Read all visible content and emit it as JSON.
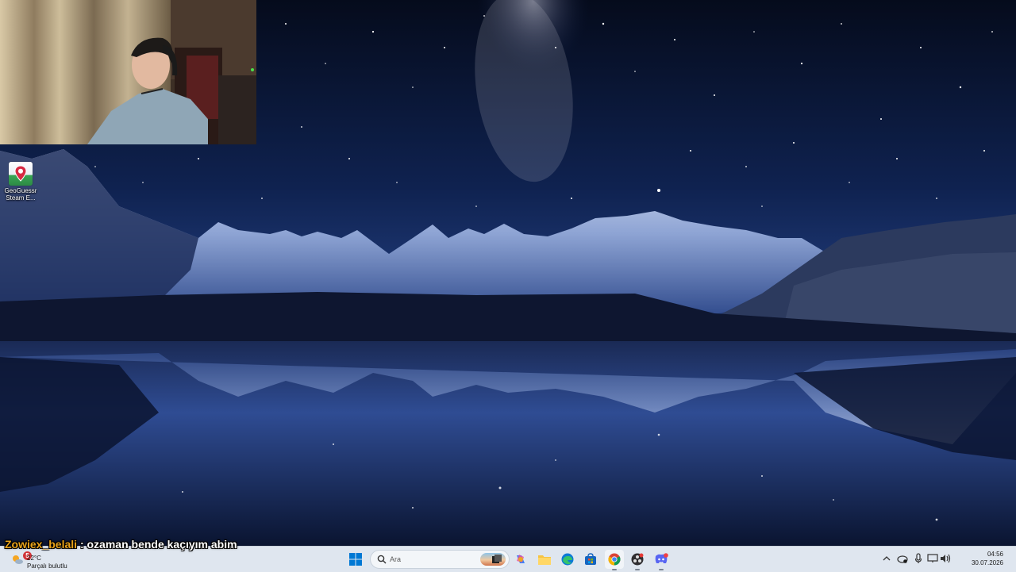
{
  "desktop": {
    "icons": [
      {
        "label_line1": "GeoGuessr",
        "label_line2": "Steam E..."
      }
    ]
  },
  "chat": {
    "username": "Zowiex_belali",
    "separator": ":",
    "message": "ozaman bende kaçıyım abim",
    "username_color": "#e8a21a"
  },
  "taskbar": {
    "weather": {
      "temperature": "22°C",
      "condition": "Parçalı bulutlu",
      "badge_count": "5"
    },
    "search": {
      "placeholder": "Ara"
    },
    "apps": [
      "start-icon",
      "search-icon",
      "task-view-icon",
      "copilot-icon",
      "file-explorer-icon",
      "edge-icon",
      "store-icon",
      "chrome-icon",
      "obs-icon",
      "discord-icon"
    ],
    "clock": {
      "time": "04:56",
      "date": "30.07.2026"
    }
  },
  "colors": {
    "taskbar_bg": "#dfe6ef",
    "sky_top": "#071024",
    "sky_horizon": "#1f3e78"
  }
}
